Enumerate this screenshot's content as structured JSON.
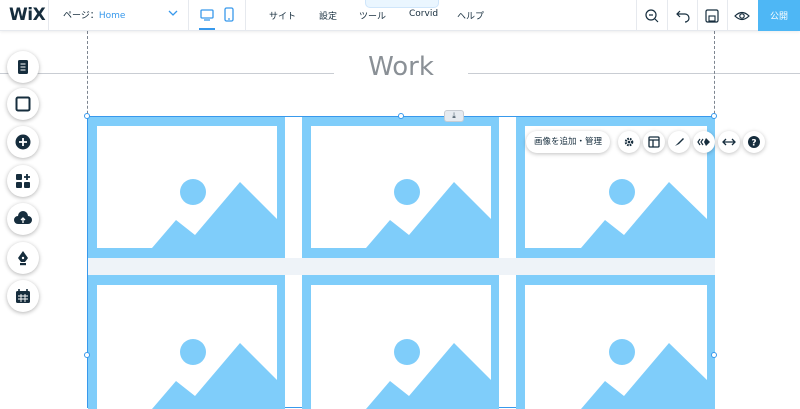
{
  "brand": {
    "logo": "WiX"
  },
  "page_selector": {
    "label": "ページ：",
    "value": "Home"
  },
  "devices": [
    {
      "name": "desktop",
      "active": true
    },
    {
      "name": "mobile",
      "active": false
    }
  ],
  "menu": [
    "サイト",
    "設定",
    "ツール",
    "Corvid",
    "ヘルプ"
  ],
  "tools": {
    "zoom": "zoom-out-icon",
    "undo": "undo-icon",
    "save": "save-icon",
    "preview": "eye-icon"
  },
  "publish_label": "公開",
  "toolbar_collapse_glyph": "⌃",
  "section_title": "Work",
  "gallery": {
    "manage_label": "画像を追加・管理",
    "download_glyph": "⤓",
    "tile_count": 6
  },
  "colors": {
    "accent": "#3899ec",
    "placeholder": "#7fcdfa",
    "publish_bg": "#4eb7f5",
    "text": "#162d3d"
  },
  "left_panel": [
    "page-icon",
    "box-icon",
    "add-icon",
    "apps-icon",
    "upload-icon",
    "pen-icon",
    "calendar-icon"
  ]
}
